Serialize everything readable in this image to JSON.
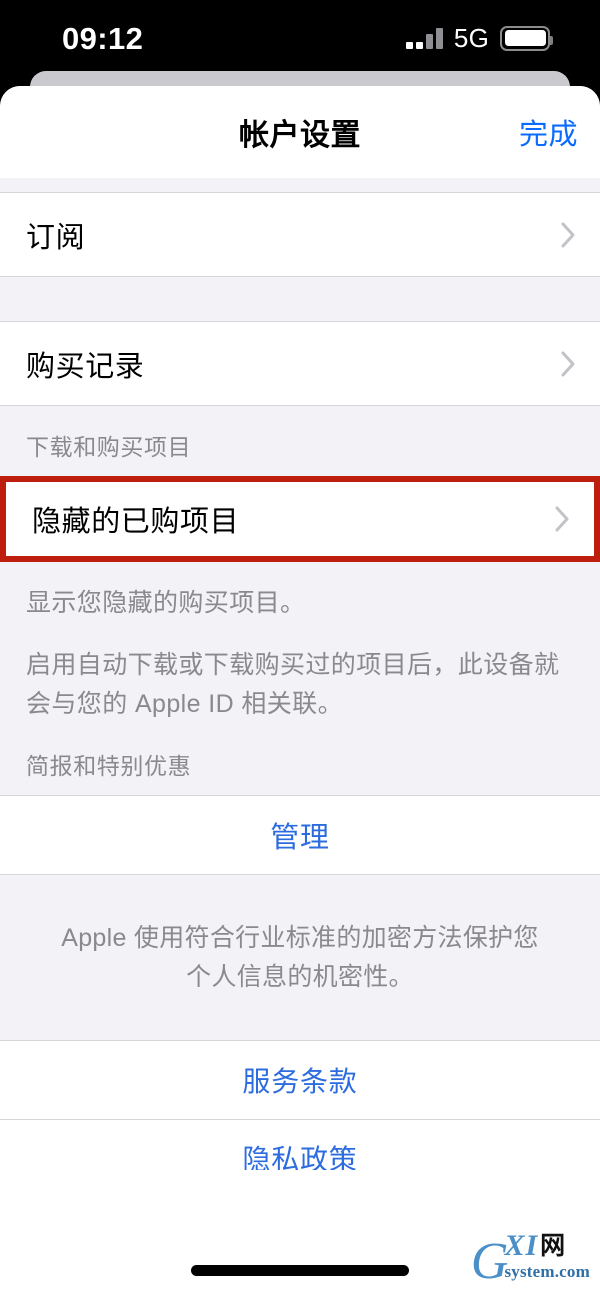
{
  "status_bar": {
    "time": "09:12",
    "network": "5G",
    "signal_icon": "signal-bars-icon",
    "battery_icon": "battery-icon"
  },
  "nav": {
    "title": "帐户设置",
    "done_label": "完成"
  },
  "groups": {
    "subscriptions_row": {
      "label": "订阅",
      "chevron_icon": "chevron-right-icon"
    },
    "purchase_history_row": {
      "label": "购买记录",
      "chevron_icon": "chevron-right-icon"
    },
    "downloads_section": {
      "header": "下载和购买项目",
      "hidden_purchases_row": {
        "label": "隐藏的已购项目",
        "chevron_icon": "chevron-right-icon",
        "highlight_color": "#be1e0e"
      },
      "footer_line_1": "显示您隐藏的购买项目。",
      "footer_line_2": "启用自动下载或下载购买过的项目后，此设备就会与您的 Apple ID 相关联。"
    },
    "newsletter_section": {
      "header": "简报和特别优惠",
      "manage_label": "管理"
    },
    "privacy_note": "Apple 使用符合行业标准的加密方法保护您个人信息的机密性。",
    "links": [
      {
        "label": "服务条款"
      },
      {
        "label": "隐私政策"
      }
    ]
  },
  "watermark": {
    "g": "G",
    "xi": "XI",
    "cn": "网",
    "domain": "system.com"
  },
  "colors": {
    "accent_blue": "#0a6cff",
    "link_blue": "#2d6cdf",
    "highlight_red": "#be1e0e",
    "group_background": "#f2f2f7",
    "card_background": "#ffffff",
    "secondary_text": "#8a8a8e"
  }
}
